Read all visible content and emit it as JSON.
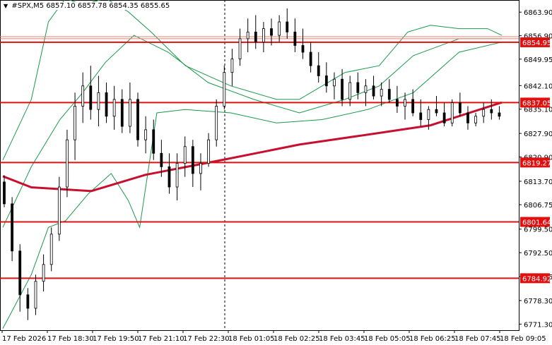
{
  "window": {
    "title_prefix": "▼",
    "symbol": "#SPX,M5",
    "ohlc": "6857.10 6857.78 6854.35 6855.65"
  },
  "chart_data": {
    "type": "candlestick",
    "symbol": "#SPX",
    "timeframe": "M5",
    "ylim": [
      6769.5,
      6867.5
    ],
    "y_ticks": [
      6863.9,
      6856.9,
      6849.95,
      6842.1,
      6835.1,
      6827.9,
      6820.9,
      6813.7,
      6806.75,
      6799.5,
      6792.5,
      6785.45,
      6778.3,
      6771.3
    ],
    "x_ticks": [
      "17 Feb 2026",
      "17 Feb 18:30",
      "17 Feb 19:50",
      "17 Feb 21:10",
      "17 Feb 22:30",
      "18 Feb 01:05",
      "18 Feb 02:25",
      "18 Feb 03:45",
      "18 Feb 05:05",
      "18 Feb 06:25",
      "18 Feb 07:45",
      "18 Feb 09:05"
    ],
    "x_tick_positions": [
      0,
      16,
      32,
      48,
      64,
      80,
      96,
      112,
      128,
      144,
      160,
      176
    ],
    "horizontal_levels": [
      {
        "price": 6854.95,
        "label": "6854.95",
        "color": "#e01010"
      },
      {
        "price": 6837.05,
        "label": "6837.05",
        "color": "#e01010"
      },
      {
        "price": 6819.27,
        "label": "6819.27",
        "color": "#e01010"
      },
      {
        "price": 6801.64,
        "label": "6801.64",
        "color": "#e01010"
      },
      {
        "price": 6784.92,
        "label": "6784.92",
        "color": "#e01010"
      }
    ],
    "current_price_lines": [
      6856.6,
      6856.0
    ],
    "vertical_separator_index": 78,
    "moving_average": {
      "color": "#c8102e",
      "points": [
        [
          0,
          6815.2
        ],
        [
          10,
          6811.9
        ],
        [
          31,
          6810.8
        ],
        [
          50,
          6815.6
        ],
        [
          78,
          6820.2
        ],
        [
          104,
          6824.6
        ],
        [
          130,
          6827.8
        ],
        [
          150,
          6830.3
        ],
        [
          175,
          6837.1
        ]
      ]
    },
    "bollinger": {
      "color": "#1a9a4a",
      "upper": [
        [
          0,
          6820
        ],
        [
          10,
          6838
        ],
        [
          16,
          6861
        ],
        [
          22,
          6868
        ],
        [
          28,
          6866
        ],
        [
          36,
          6868
        ],
        [
          44,
          6864
        ],
        [
          52,
          6858
        ],
        [
          64,
          6848
        ],
        [
          80,
          6842
        ],
        [
          96,
          6838
        ],
        [
          104,
          6838
        ],
        [
          112,
          6842
        ],
        [
          120,
          6846
        ],
        [
          132,
          6848
        ],
        [
          142,
          6858
        ],
        [
          150,
          6860
        ],
        [
          160,
          6859
        ],
        [
          170,
          6859
        ],
        [
          175,
          6857
        ]
      ],
      "middle": [
        [
          0,
          6800
        ],
        [
          10,
          6818
        ],
        [
          20,
          6832
        ],
        [
          28,
          6840
        ],
        [
          36,
          6849
        ],
        [
          46,
          6857
        ],
        [
          58,
          6852
        ],
        [
          72,
          6843
        ],
        [
          88,
          6838
        ],
        [
          104,
          6834
        ],
        [
          120,
          6838
        ],
        [
          132,
          6842
        ],
        [
          144,
          6851
        ],
        [
          160,
          6856
        ],
        [
          175,
          6856
        ]
      ],
      "lower": [
        [
          0,
          6770
        ],
        [
          10,
          6786
        ],
        [
          16,
          6800
        ],
        [
          22,
          6802
        ],
        [
          30,
          6810
        ],
        [
          38,
          6816
        ],
        [
          44,
          6808
        ],
        [
          48,
          6800
        ],
        [
          54,
          6834
        ],
        [
          64,
          6835
        ],
        [
          80,
          6834
        ],
        [
          96,
          6831
        ],
        [
          112,
          6832
        ],
        [
          128,
          6835
        ],
        [
          144,
          6840
        ],
        [
          160,
          6852
        ],
        [
          175,
          6855
        ]
      ]
    },
    "candles": [
      [
        6813.5,
        6815.5,
        6806.0,
        6807.0
      ],
      [
        6807.0,
        6809.0,
        6790.0,
        6793.0
      ],
      [
        6793.0,
        6795.0,
        6775.0,
        6780.0
      ],
      [
        6780.0,
        6782.0,
        6772.5,
        6776.0
      ],
      [
        6776.0,
        6786.0,
        6774.0,
        6784.0
      ],
      [
        6784.0,
        6792.0,
        6781.0,
        6789.0
      ],
      [
        6789.0,
        6800.0,
        6787.0,
        6798.0
      ],
      [
        6798.0,
        6815.0,
        6796.0,
        6812.0
      ],
      [
        6812.0,
        6829.0,
        6809.0,
        6826.0
      ],
      [
        6826.0,
        6840.0,
        6820.0,
        6836.0
      ],
      [
        6836.0,
        6846.0,
        6831.0,
        6842.0
      ],
      [
        6842.0,
        6848.0,
        6832.0,
        6835.0
      ],
      [
        6835.0,
        6845.0,
        6830.0,
        6840.0
      ],
      [
        6840.0,
        6843.0,
        6831.0,
        6833.0
      ],
      [
        6833.0,
        6842.0,
        6829.0,
        6838.0
      ],
      [
        6838.0,
        6841.0,
        6828.0,
        6830.0
      ],
      [
        6830.0,
        6843.0,
        6828.0,
        6838.0
      ],
      [
        6838.0,
        6840.0,
        6824.0,
        6826.0
      ],
      [
        6826.0,
        6833.0,
        6822.0,
        6829.0
      ],
      [
        6829.0,
        6832.0,
        6820.0,
        6822.0
      ],
      [
        6822.0,
        6826.0,
        6815.0,
        6818.0
      ],
      [
        6818.0,
        6822.0,
        6810.0,
        6812.0
      ],
      [
        6812.0,
        6822.0,
        6808.0,
        6819.0
      ],
      [
        6819.0,
        6827.0,
        6815.0,
        6824.0
      ],
      [
        6824.0,
        6826.0,
        6812.0,
        6816.0
      ],
      [
        6816.0,
        6822.0,
        6811.0,
        6819.0
      ],
      [
        6819.0,
        6828.0,
        6818.0,
        6826.0
      ],
      [
        6826.0,
        6838.0,
        6824.0,
        6836.0
      ],
      [
        6836.0,
        6848.0,
        6835.0,
        6846.0
      ],
      [
        6846.0,
        6853.0,
        6842.0,
        6850.0
      ],
      [
        6850.0,
        6859.0,
        6848.0,
        6856.0
      ],
      [
        6856.0,
        6862.0,
        6852.0,
        6858.0
      ],
      [
        6858.0,
        6863.0,
        6853.0,
        6855.0
      ],
      [
        6855.0,
        6861.0,
        6852.0,
        6859.0
      ],
      [
        6859.0,
        6862.0,
        6854.0,
        6857.0
      ],
      [
        6857.0,
        6863.0,
        6855.0,
        6861.0
      ],
      [
        6861.0,
        6865.0,
        6856.0,
        6858.0
      ],
      [
        6858.0,
        6862.0,
        6852.0,
        6854.0
      ],
      [
        6854.0,
        6859.0,
        6850.0,
        6852.0
      ],
      [
        6852.0,
        6855.0,
        6846.0,
        6848.0
      ],
      [
        6848.0,
        6852.0,
        6843.0,
        6845.0
      ],
      [
        6845.0,
        6849.0,
        6840.0,
        6842.0
      ],
      [
        6842.0,
        6846.0,
        6838.0,
        6844.0
      ],
      [
        6844.0,
        6847.0,
        6836.0,
        6838.0
      ],
      [
        6838.0,
        6845.0,
        6836.0,
        6843.0
      ],
      [
        6843.0,
        6846.0,
        6838.0,
        6840.0
      ],
      [
        6840.0,
        6844.0,
        6836.0,
        6842.0
      ],
      [
        6842.0,
        6845.0,
        6838.0,
        6839.0
      ],
      [
        6839.0,
        6843.0,
        6836.0,
        6841.0
      ],
      [
        6841.0,
        6844.0,
        6837.0,
        6838.0
      ],
      [
        6838.0,
        6842.0,
        6834.0,
        6836.0
      ],
      [
        6836.0,
        6840.0,
        6832.0,
        6838.0
      ],
      [
        6838.0,
        6841.0,
        6833.0,
        6834.0
      ],
      [
        6834.0,
        6838.0,
        6830.0,
        6832.0
      ],
      [
        6832.0,
        6836.0,
        6829.0,
        6835.0
      ],
      [
        6835.0,
        6839.0,
        6833.0,
        6834.0
      ],
      [
        6834.0,
        6837.0,
        6830.0,
        6831.0
      ],
      [
        6831.0,
        6838.0,
        6830.0,
        6837.0
      ],
      [
        6837.0,
        6840.0,
        6833.0,
        6834.0
      ],
      [
        6834.0,
        6836.0,
        6829.0,
        6831.0
      ],
      [
        6831.0,
        6834.0,
        6830.0,
        6833.0
      ],
      [
        6833.0,
        6837.0,
        6831.0,
        6835.0
      ],
      [
        6835.0,
        6838.0,
        6832.0,
        6834.0
      ],
      [
        6834.0,
        6836.0,
        6832.0,
        6833.0
      ]
    ]
  },
  "price_axis_labels": [
    {
      "price": 6863.9,
      "text": "6863.90"
    },
    {
      "price": 6856.9,
      "text": "6856.90"
    },
    {
      "price": 6849.95,
      "text": "6849.95"
    },
    {
      "price": 6842.1,
      "text": "6842.10"
    },
    {
      "price": 6835.1,
      "text": "6835.10"
    },
    {
      "price": 6827.9,
      "text": "6827.90"
    },
    {
      "price": 6820.9,
      "text": "6820.90"
    },
    {
      "price": 6813.7,
      "text": "6813.70"
    },
    {
      "price": 6806.75,
      "text": "6806.75"
    },
    {
      "price": 6799.5,
      "text": "6799.50"
    },
    {
      "price": 6792.5,
      "text": "6792.50"
    },
    {
      "price": 6785.45,
      "text": "6785.45"
    },
    {
      "price": 6778.3,
      "text": "6778.30"
    },
    {
      "price": 6771.3,
      "text": "6771.30"
    }
  ],
  "colors": {
    "background": "#ffffff",
    "candle": "#000000",
    "level_line": "#e01010",
    "ma_line": "#c8102e",
    "bands": "#1a9a4a",
    "axis_text": "#000000",
    "separator": "#000000"
  }
}
